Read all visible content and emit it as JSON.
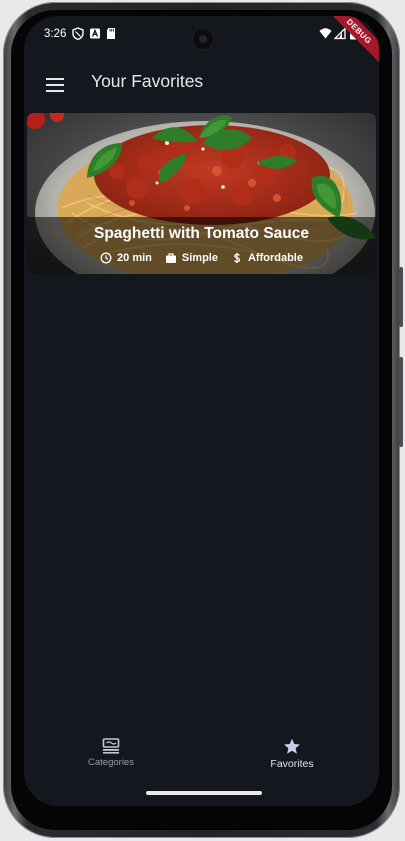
{
  "status_bar": {
    "time": "3:26",
    "left_icons": [
      "vpn-shield-icon",
      "a-badge-icon",
      "sd-card-icon"
    ],
    "right_icons": [
      "wifi-icon",
      "cell-signal-icon",
      "battery-icon"
    ],
    "debug_banner": "DEBUG"
  },
  "app_bar": {
    "menu_icon": "hamburger-menu-icon",
    "title": "Your Favorites"
  },
  "meals": [
    {
      "title": "Spaghetti with Tomato Sauce",
      "image": "spaghetti-with-tomato-sauce-photo",
      "duration": "20 min",
      "complexity": "Simple",
      "affordability": "Affordable",
      "icons": {
        "duration": "clock-icon",
        "complexity": "briefcase-icon",
        "affordability": "dollar-icon"
      }
    }
  ],
  "bottom_nav": {
    "items": [
      {
        "label": "Categories",
        "icon": "set-meal-icon",
        "selected": false
      },
      {
        "label": "Favorites",
        "icon": "star-icon",
        "selected": true
      }
    ]
  },
  "colors": {
    "screen_background": "#14171d",
    "text_primary": "#e7e8ec",
    "nav_unselected": "#9a9eab",
    "debug_banner": "#a3192b"
  }
}
